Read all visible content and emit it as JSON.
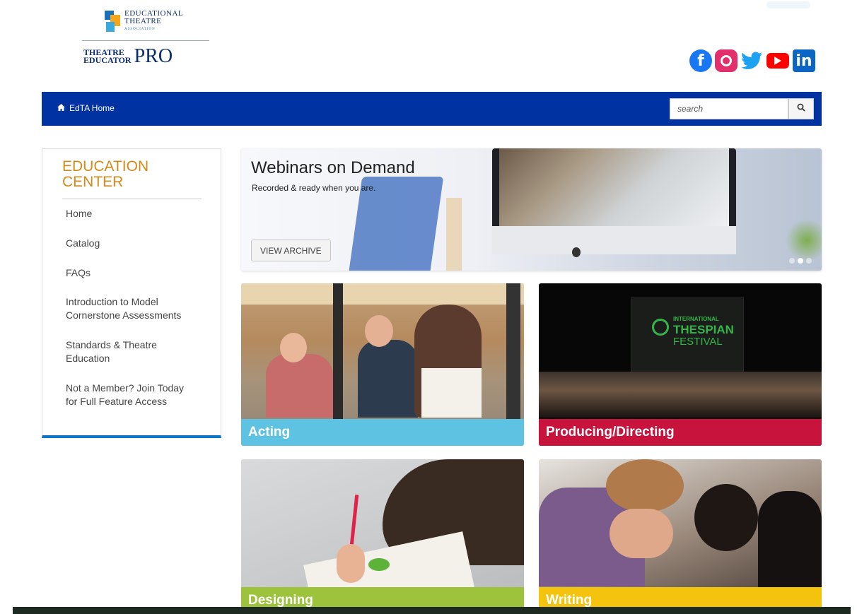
{
  "header": {
    "edta_logo_lines": [
      "EDUCATIONAL",
      "THEATRE",
      "ASSOCIATION"
    ],
    "tep_logo_small": [
      "THEATRE",
      "EDUCATOR"
    ],
    "tep_logo_big": "PRO",
    "social": [
      {
        "name": "facebook",
        "glyph": "f"
      },
      {
        "name": "instagram",
        "glyph": ""
      },
      {
        "name": "twitter",
        "glyph": "🐦"
      },
      {
        "name": "youtube",
        "glyph": ""
      },
      {
        "name": "linkedin",
        "glyph": "in"
      }
    ]
  },
  "nav": {
    "home_label": "EdTA Home",
    "home_icon": "home-icon",
    "search_placeholder": "search",
    "search_icon": "search-icon"
  },
  "sidebar": {
    "title": "EDUCATION CENTER",
    "items": [
      {
        "label": "Home"
      },
      {
        "label": "Catalog"
      },
      {
        "label": "FAQs"
      },
      {
        "label": "Introduction to Model Cornerstone Assessments"
      },
      {
        "label": "Standards & Theatre Education"
      },
      {
        "label": "Not a Member? Join Today for Full Feature Access"
      }
    ]
  },
  "hero": {
    "title": "Webinars on Demand",
    "subtitle": "Recorded & ready when you are.",
    "button_label": "VIEW ARCHIVE",
    "dots": 3,
    "active_dot": 1
  },
  "tiles": [
    {
      "label": "Acting",
      "color": "#5ec2e3"
    },
    {
      "label": "Producing/Directing",
      "color": "#c8143c"
    },
    {
      "label": "Designing",
      "color": "#9dc23b"
    },
    {
      "label": "Writing",
      "color": "#f3c30e"
    }
  ],
  "tile_image_text": {
    "producing_banner_lines": [
      "INTERNATIONAL",
      "THESPIAN",
      "FESTIVAL"
    ]
  },
  "colors": {
    "nav_blue": "#0033a1",
    "title_orange": "#d38a1a",
    "sidebar_bottom": "#0b76c6"
  }
}
